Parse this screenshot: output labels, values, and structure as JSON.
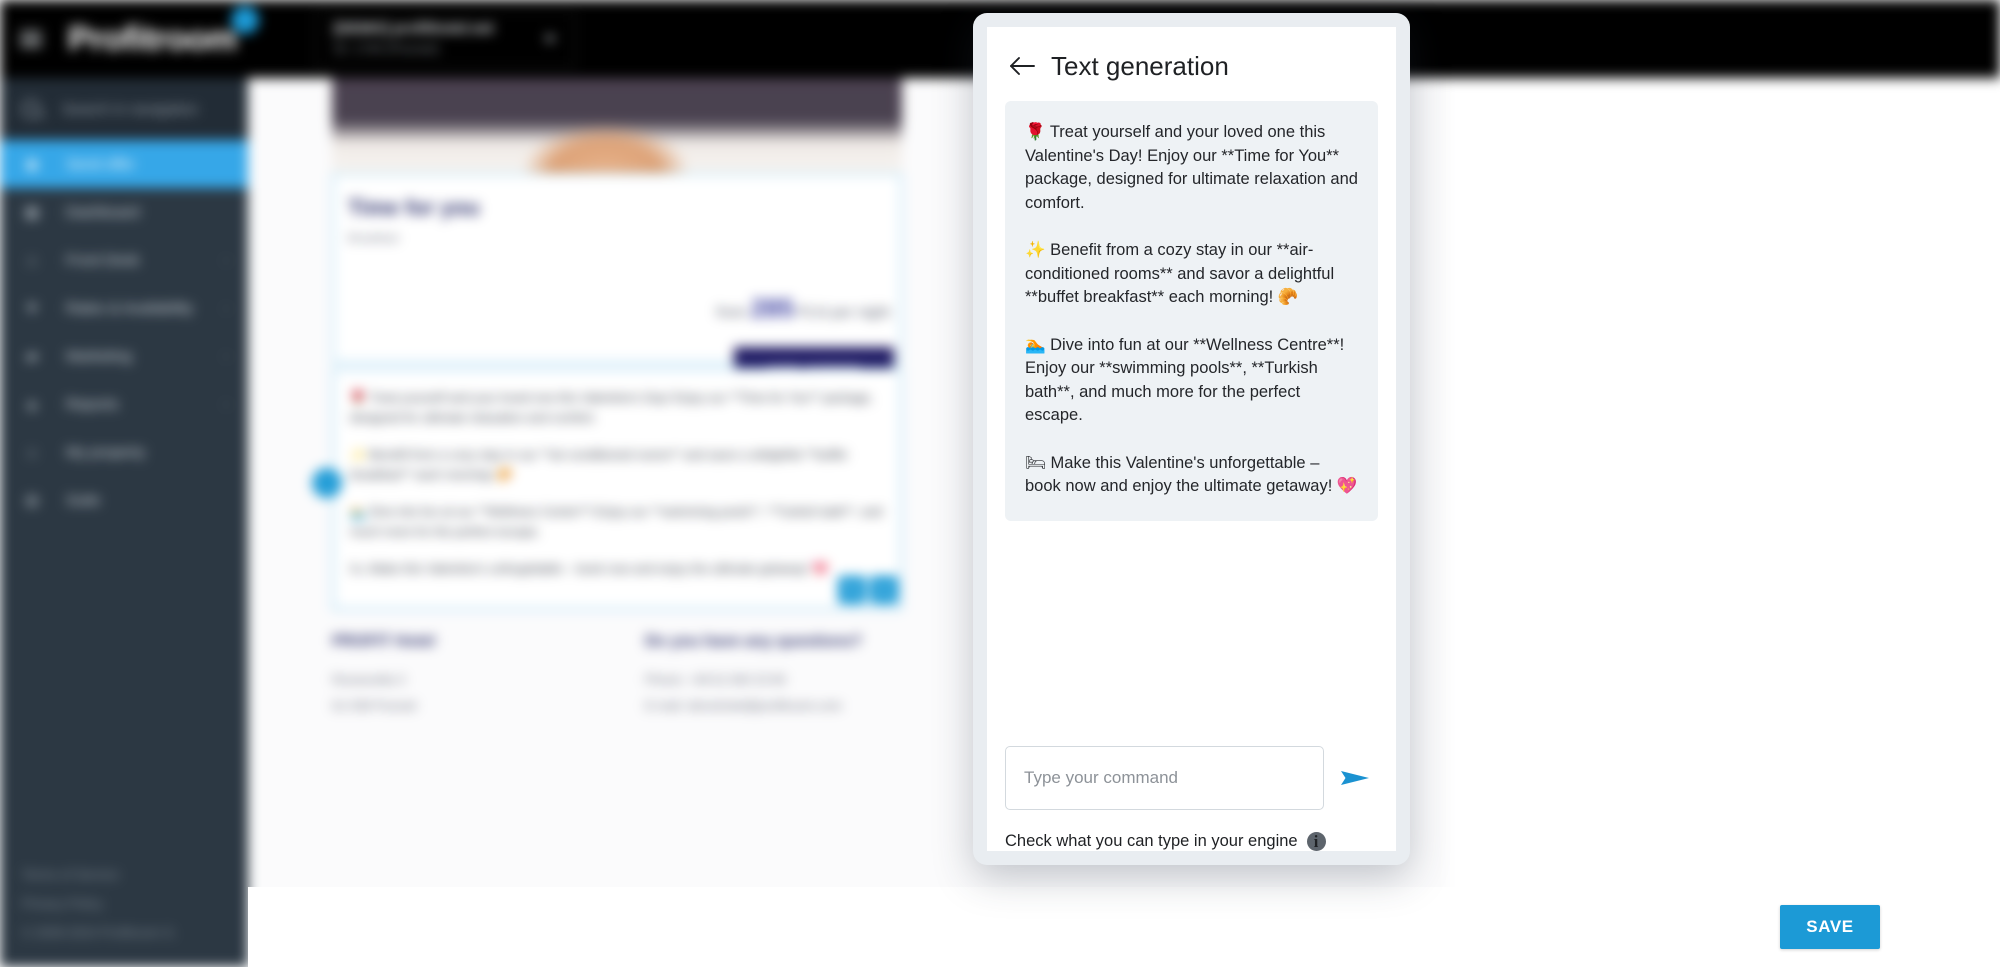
{
  "topbar": {
    "menu_icon": "hamburger-icon",
    "brand": "Profitroom",
    "property_name": "[DEMO] profithotel.net",
    "property_id": "ID: 1794 (Poznań)",
    "caret_icon": "chevron-down-icon"
  },
  "sidebar": {
    "search_placeholder": "Search in navigation",
    "search_icon": "search-icon",
    "items": [
      {
        "label": "Send offer",
        "icon": "send-offer-icon",
        "active": true,
        "expandable": false
      },
      {
        "label": "Dashboard",
        "icon": "dashboard-icon",
        "active": false,
        "expandable": false
      },
      {
        "label": "Front Desk",
        "icon": "front-desk-icon",
        "active": false,
        "expandable": true
      },
      {
        "label": "Rates & Availability",
        "icon": "rates-icon",
        "active": false,
        "expandable": true
      },
      {
        "label": "Marketing",
        "icon": "marketing-icon",
        "active": false,
        "expandable": true
      },
      {
        "label": "Reports",
        "icon": "reports-icon",
        "active": false,
        "expandable": true
      },
      {
        "label": "My property",
        "icon": "property-icon",
        "active": false,
        "expandable": false
      },
      {
        "label": "Suite",
        "icon": "suite-icon",
        "active": false,
        "expandable": false
      }
    ],
    "footer": {
      "terms": "Terms of Service",
      "privacy": "Privacy Policy",
      "copyright": "© 2009-2024 Profitroom S."
    }
  },
  "offer_preview": {
    "title": "Time for you",
    "subtitle": "Breakfast",
    "price_prefix": "from",
    "price_value": "285",
    "price_suffix": "PLN per night",
    "cta_label": "SEE OFFER",
    "body_paragraphs": [
      "🌹 Treat yourself and your loved one this Valentine's Day! Enjoy our **Time for You** package, designed for ultimate relaxation and comfort.",
      "✨ Benefit from a cozy stay in our **air-conditioned rooms** and savor a delightful **buffet breakfast** each morning! 🥐",
      "🏊 Dive into fun at our **Wellness Centre**! Enjoy our **swimming pools**, **Turkish bath**, and much more for the perfect escape.",
      "🛏 Make this Valentine's unforgettable – book now and enjoy the ultimate getaway! 💖"
    ],
    "block_handle_icon": "drag-handle-icon",
    "tool_icons": [
      "edit-icon",
      "ai-generate-icon"
    ],
    "footer_left_title": "PROFIT Hotel",
    "footer_left_lines": [
      "Roosevelta 3",
      "61-538 Poznań"
    ],
    "footer_right_title": "Do you have any questions?",
    "footer_right_lines": [
      "Phone: +48 61 840 23 80",
      "E-mail: demohotel@profitroom.com"
    ]
  },
  "modal": {
    "back_icon": "back-arrow-icon",
    "title": "Text generation",
    "message_paragraphs": [
      "🌹 Treat yourself and your loved one this Valentine's Day! Enjoy our **Time for You** package, designed for ultimate relaxation and comfort.",
      "✨ Benefit from a cozy stay in our **air-conditioned rooms** and savor a delightful **buffet breakfast** each morning! 🥐",
      "🏊 Dive into fun at our **Wellness Centre**! Enjoy our **swimming pools**, **Turkish bath**, and much more for the perfect escape.",
      "🛏 Make this Valentine's unforgettable – book now and enjoy the ultimate getaway! 💖"
    ],
    "input_placeholder": "Type your command",
    "input_value": "",
    "send_icon": "send-icon",
    "hint_text": "Check what you can type in your engine",
    "hint_icon": "info-icon",
    "bubble_color": "#eef2f5"
  },
  "footer_actions": {
    "save_label": "SAVE"
  },
  "colors": {
    "accent_blue": "#1c9ad6",
    "sidebar_bg": "#2c3843",
    "sidebar_active": "#36a7e8",
    "topbar_bg": "#000000",
    "offer_navy": "#201b64"
  }
}
